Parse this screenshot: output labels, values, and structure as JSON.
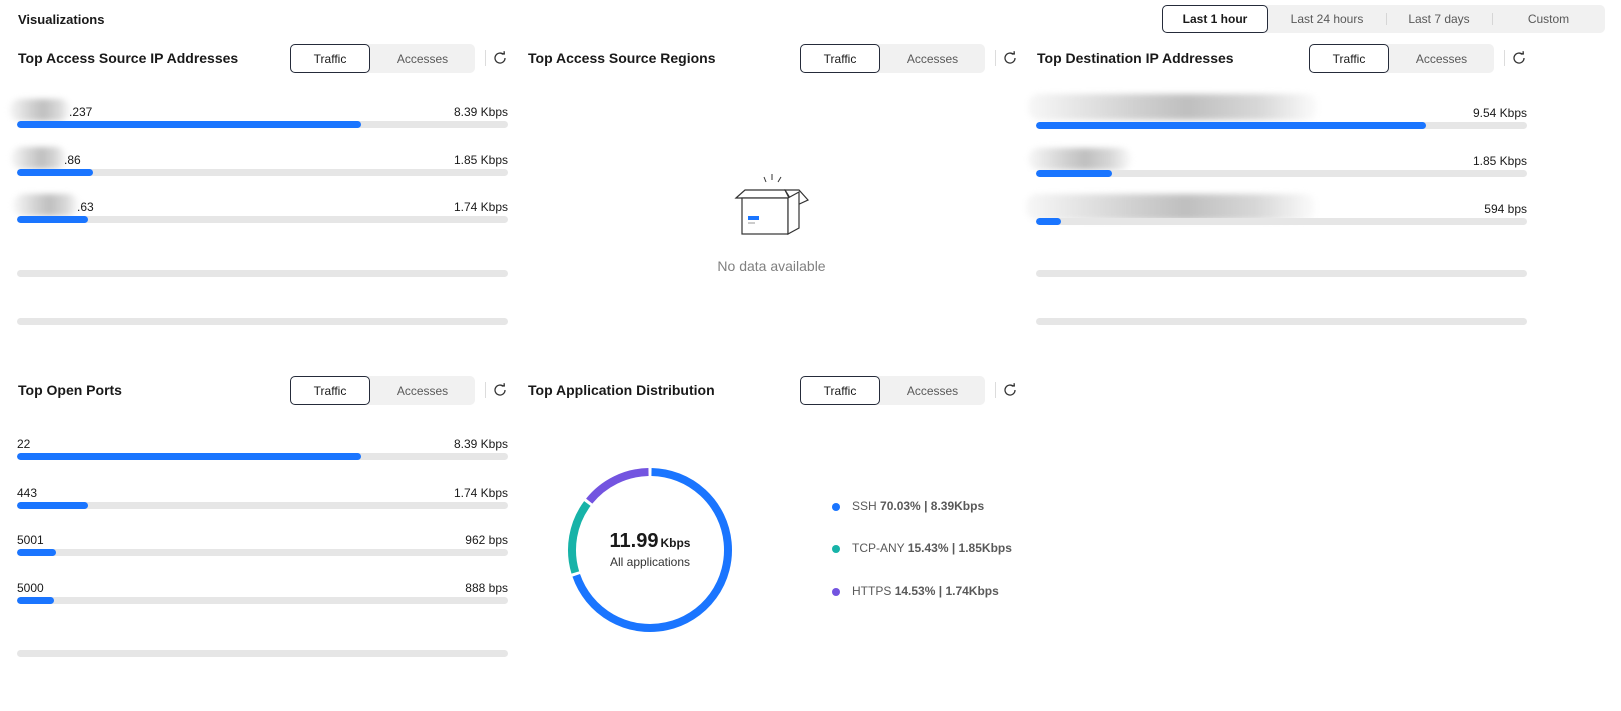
{
  "page": {
    "title": "Visualizations"
  },
  "time_range": {
    "options": [
      "Last 1 hour",
      "Last 24 hours",
      "Last 7 days",
      "Custom"
    ],
    "selected": "Last 1 hour"
  },
  "toggle": {
    "traffic": "Traffic",
    "accesses": "Accesses",
    "selected": "Traffic"
  },
  "colors": {
    "bar": "#1a75ff",
    "track": "#e6e6e6",
    "ssh": "#1a75ff",
    "tcp_any": "#17b3a8",
    "https": "#7354e0"
  },
  "panels": {
    "source_ips": {
      "title": "Top Access Source IP Addresses",
      "rows": [
        {
          "label": ".237",
          "value": "8.39 Kbps",
          "fraction": 0.7
        },
        {
          "label": ".86",
          "value": "1.85 Kbps",
          "fraction": 0.155
        },
        {
          "label": ".63",
          "value": "1.74 Kbps",
          "fraction": 0.145
        }
      ]
    },
    "source_regions": {
      "title": "Top Access Source Regions",
      "empty_text": "No data available"
    },
    "destination_ips": {
      "title": "Top Destination IP Addresses",
      "rows": [
        {
          "label": "",
          "value": "9.54 Kbps",
          "fraction": 0.795
        },
        {
          "label": "",
          "value": "1.85 Kbps",
          "fraction": 0.155
        },
        {
          "label": "",
          "value": "594 bps",
          "fraction": 0.05
        }
      ]
    },
    "open_ports": {
      "title": "Top Open Ports",
      "rows": [
        {
          "label": "22",
          "value": "8.39 Kbps",
          "fraction": 0.7
        },
        {
          "label": "443",
          "value": "1.74 Kbps",
          "fraction": 0.145
        },
        {
          "label": "5001",
          "value": "962 bps",
          "fraction": 0.08
        },
        {
          "label": "5000",
          "value": "888 bps",
          "fraction": 0.075
        }
      ]
    },
    "app_distribution": {
      "title": "Top Application Distribution",
      "total_value": "11.99",
      "total_unit": "Kbps",
      "total_caption": "All applications",
      "legend": [
        {
          "name": "SSH",
          "percent": "70.03%",
          "rate": "8.39Kbps",
          "share": 70.03,
          "color": "#1a75ff"
        },
        {
          "name": "TCP-ANY",
          "percent": "15.43%",
          "rate": "1.85Kbps",
          "share": 15.43,
          "color": "#17b3a8"
        },
        {
          "name": "HTTPS",
          "percent": "14.53%",
          "rate": "1.74Kbps",
          "share": 14.53,
          "color": "#7354e0"
        }
      ]
    }
  }
}
